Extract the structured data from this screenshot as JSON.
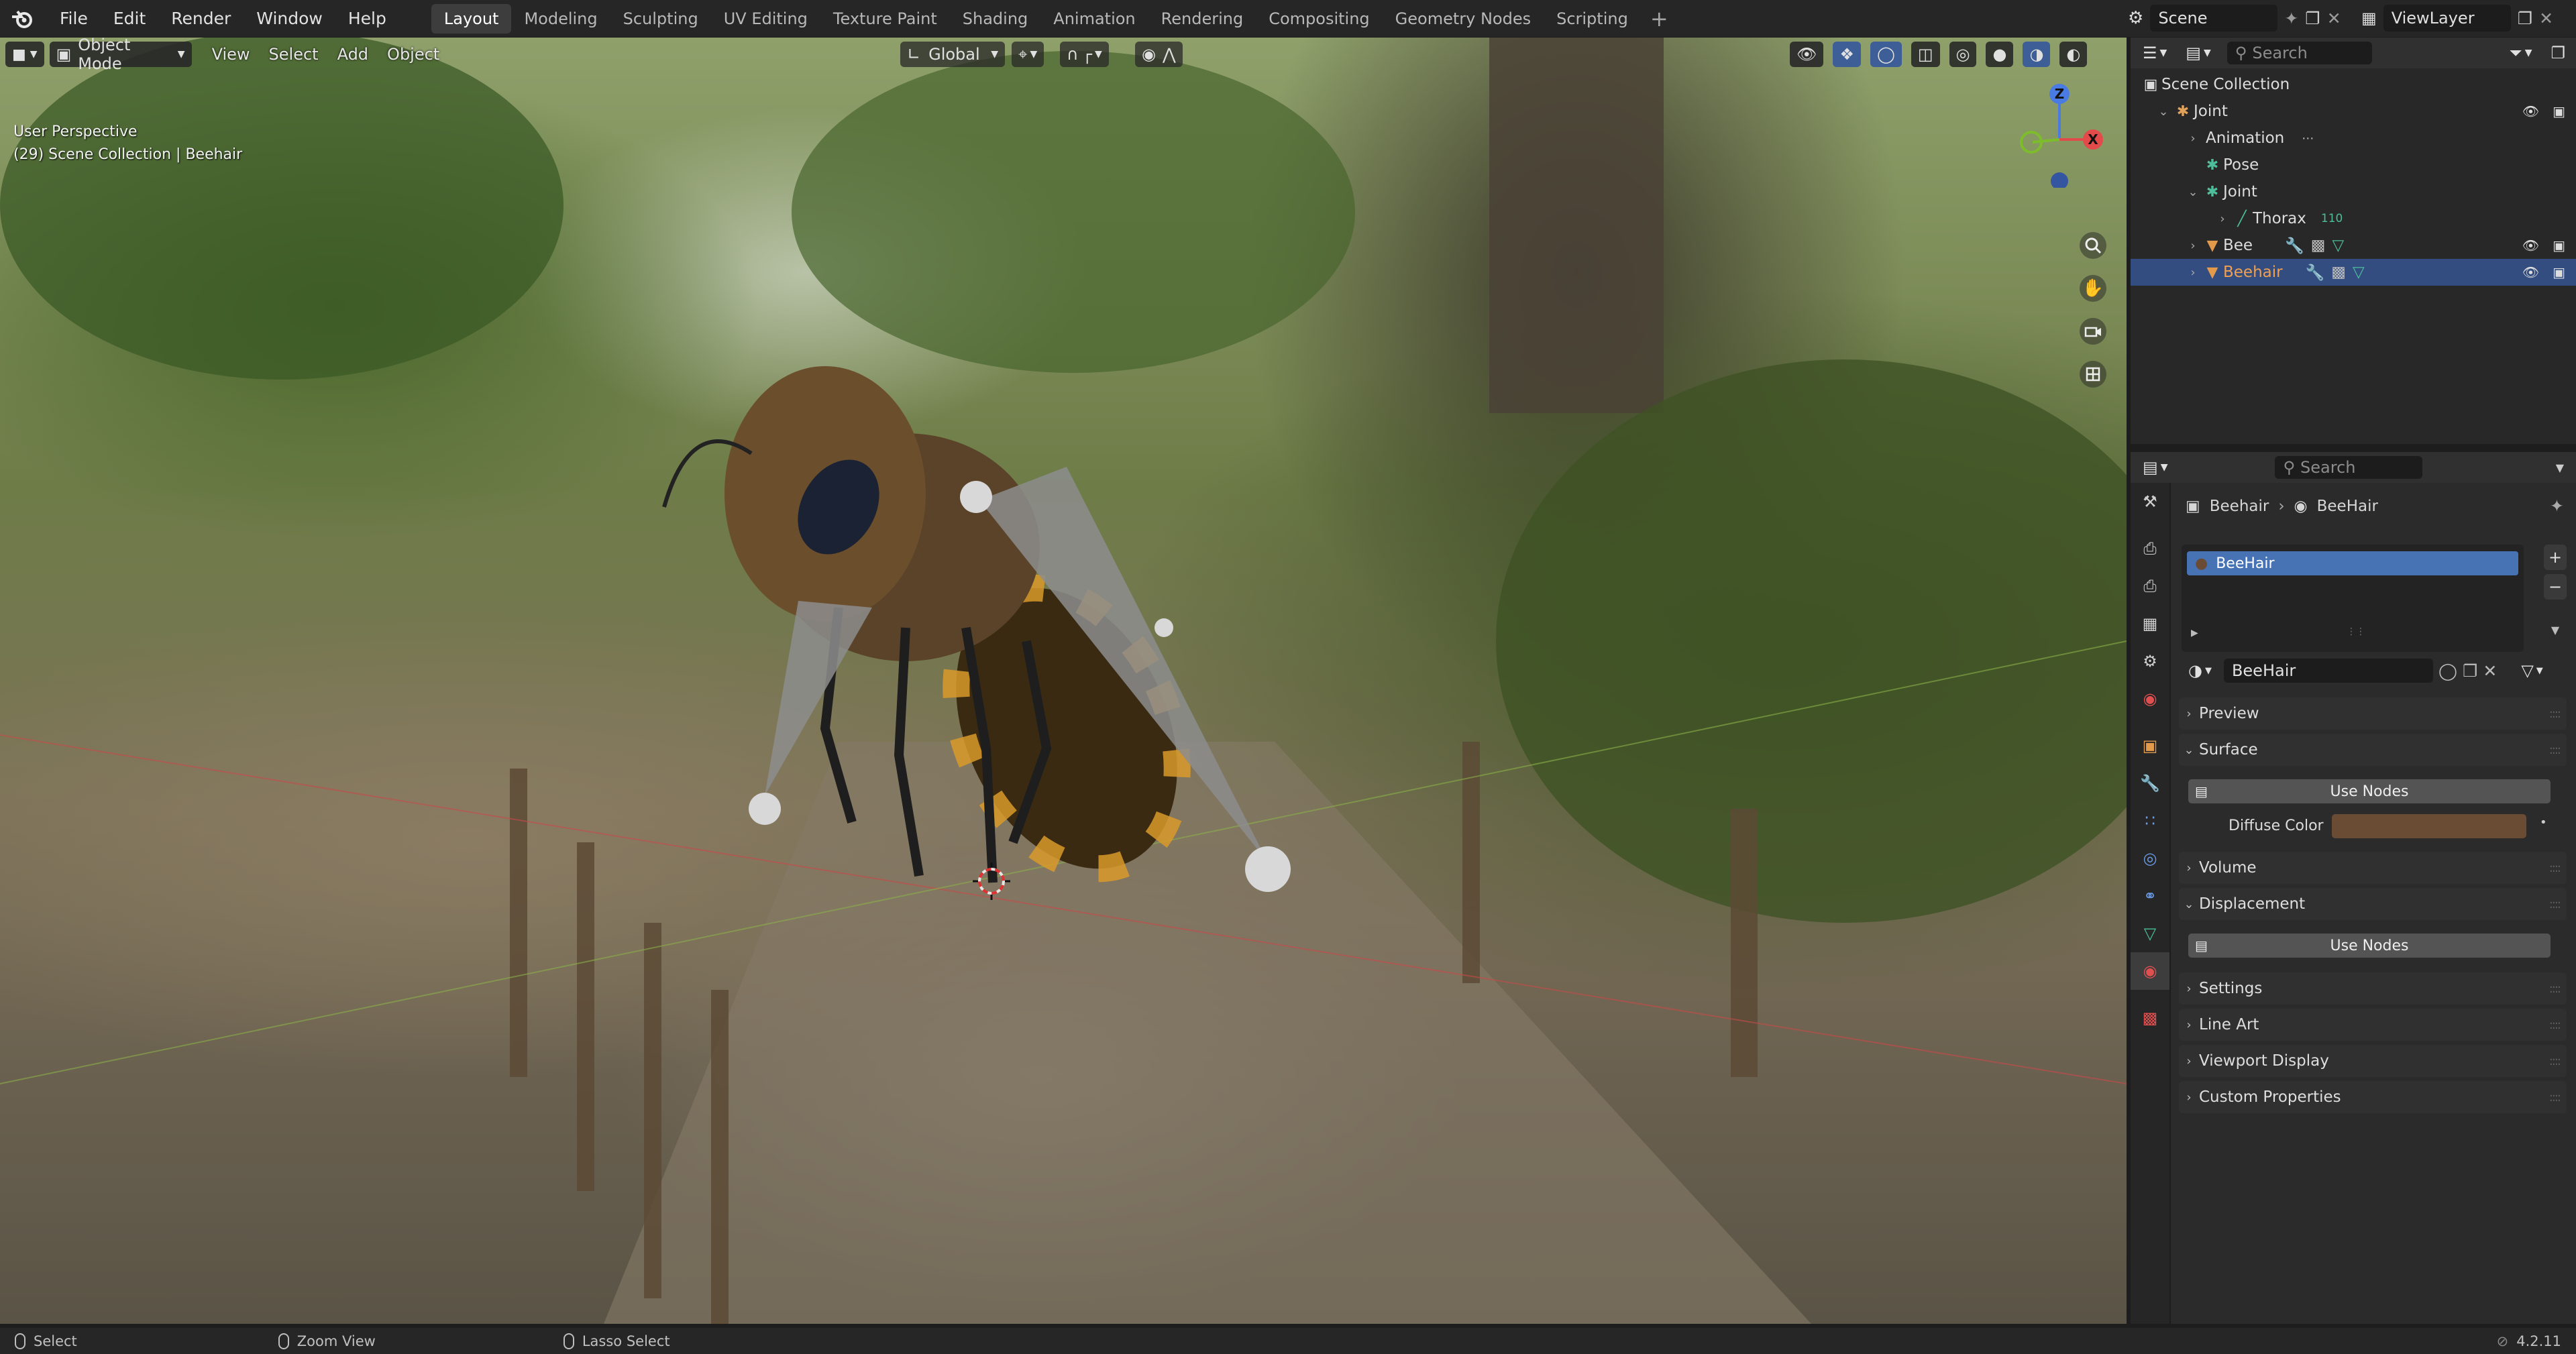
{
  "menu": {
    "items": [
      "File",
      "Edit",
      "Render",
      "Window",
      "Help"
    ]
  },
  "workspaces": {
    "tabs": [
      "Layout",
      "Modeling",
      "Sculpting",
      "UV Editing",
      "Texture Paint",
      "Shading",
      "Animation",
      "Rendering",
      "Compositing",
      "Geometry Nodes",
      "Scripting"
    ],
    "active": "Layout",
    "add_label": "+"
  },
  "scene": {
    "name": "Scene"
  },
  "view_layer": {
    "name": "ViewLayer"
  },
  "viewport": {
    "mode": "Object Mode",
    "menus": [
      "View",
      "Select",
      "Add",
      "Object"
    ],
    "orientation": "Global",
    "info_line1": "User Perspective",
    "info_line2": "(29) Scene Collection | Beehair",
    "gizmo": {
      "z": "Z",
      "x": "X",
      "y": "Y"
    }
  },
  "outliner": {
    "search_placeholder": "Search",
    "rows": [
      {
        "label": "Scene Collection",
        "icon": "collection-icon",
        "indent": 0
      },
      {
        "label": "Joint",
        "icon": "armature-icon",
        "indent": 1,
        "expanded": true
      },
      {
        "label": "Animation",
        "icon": "action-icon",
        "indent": 2
      },
      {
        "label": "Pose",
        "icon": "pose-icon",
        "indent": 2
      },
      {
        "label": "Joint",
        "icon": "armature-data-icon",
        "indent": 2,
        "expanded": true
      },
      {
        "label": "Thorax",
        "icon": "bone-icon",
        "indent": 3,
        "badge": "110"
      },
      {
        "label": "Bee",
        "icon": "mesh-icon",
        "indent": 2
      },
      {
        "label": "Beehair",
        "icon": "mesh-icon",
        "indent": 2,
        "selected": true
      }
    ]
  },
  "properties": {
    "search_placeholder": "Search",
    "breadcrumb_object": "Beehair",
    "breadcrumb_material": "BeeHair",
    "slot_name": "BeeHair",
    "material_name": "BeeHair",
    "panels": {
      "preview": "Preview",
      "surface": "Surface",
      "use_nodes": "Use Nodes",
      "diffuse_label": "Diffuse Color",
      "diffuse_color": "#6a4b34",
      "volume": "Volume",
      "displacement": "Displacement",
      "use_nodes_2": "Use Nodes",
      "settings": "Settings",
      "line_art": "Line Art",
      "viewport_display": "Viewport Display",
      "custom_properties": "Custom Properties"
    }
  },
  "status": {
    "select": "Select",
    "zoom": "Zoom View",
    "lasso": "Lasso Select",
    "version": "4.2.11"
  },
  "colors": {
    "accent": "#4772b3",
    "selection_row": "#334d80",
    "axis_x": "#e34a4a",
    "axis_y": "#7dbd2c",
    "axis_z": "#4a7be3"
  }
}
